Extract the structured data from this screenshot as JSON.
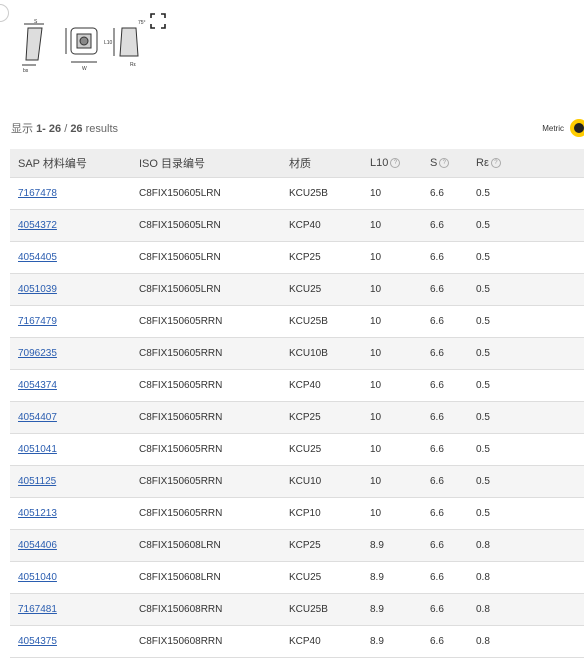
{
  "diagram_labels": {
    "s": "S",
    "w": "W",
    "l10": "L10",
    "angle": "75°",
    "re": "Rε",
    "bs": "bs"
  },
  "summary": {
    "prefix": "显示 ",
    "range": "1- 26",
    "separator": " / ",
    "total": "26",
    "suffix": " results"
  },
  "unit_toggle": {
    "label": "Metric"
  },
  "table": {
    "headers": {
      "sap": "SAP 材料编号",
      "iso": "ISO 目录编号",
      "grade": "材质",
      "l10": "L10",
      "s": "S",
      "re": "Rε"
    },
    "info_glyph": "?",
    "rows": [
      {
        "sap": "7167478",
        "iso": "C8FIX150605LRN",
        "grade": "KCU25B",
        "l10": "10",
        "s": "6.6",
        "re": "0.5"
      },
      {
        "sap": "4054372",
        "iso": "C8FIX150605LRN",
        "grade": "KCP40",
        "l10": "10",
        "s": "6.6",
        "re": "0.5"
      },
      {
        "sap": "4054405",
        "iso": "C8FIX150605LRN",
        "grade": "KCP25",
        "l10": "10",
        "s": "6.6",
        "re": "0.5"
      },
      {
        "sap": "4051039",
        "iso": "C8FIX150605LRN",
        "grade": "KCU25",
        "l10": "10",
        "s": "6.6",
        "re": "0.5"
      },
      {
        "sap": "7167479",
        "iso": "C8FIX150605RRN",
        "grade": "KCU25B",
        "l10": "10",
        "s": "6.6",
        "re": "0.5"
      },
      {
        "sap": "7096235",
        "iso": "C8FIX150605RRN",
        "grade": "KCU10B",
        "l10": "10",
        "s": "6.6",
        "re": "0.5"
      },
      {
        "sap": "4054374",
        "iso": "C8FIX150605RRN",
        "grade": "KCP40",
        "l10": "10",
        "s": "6.6",
        "re": "0.5"
      },
      {
        "sap": "4054407",
        "iso": "C8FIX150605RRN",
        "grade": "KCP25",
        "l10": "10",
        "s": "6.6",
        "re": "0.5"
      },
      {
        "sap": "4051041",
        "iso": "C8FIX150605RRN",
        "grade": "KCU25",
        "l10": "10",
        "s": "6.6",
        "re": "0.5"
      },
      {
        "sap": "4051125",
        "iso": "C8FIX150605RRN",
        "grade": "KCU10",
        "l10": "10",
        "s": "6.6",
        "re": "0.5"
      },
      {
        "sap": "4051213",
        "iso": "C8FIX150605RRN",
        "grade": "KCP10",
        "l10": "10",
        "s": "6.6",
        "re": "0.5"
      },
      {
        "sap": "4054406",
        "iso": "C8FIX150608LRN",
        "grade": "KCP25",
        "l10": "8.9",
        "s": "6.6",
        "re": "0.8"
      },
      {
        "sap": "4051040",
        "iso": "C8FIX150608LRN",
        "grade": "KCU25",
        "l10": "8.9",
        "s": "6.6",
        "re": "0.8"
      },
      {
        "sap": "7167481",
        "iso": "C8FIX150608RRN",
        "grade": "KCU25B",
        "l10": "8.9",
        "s": "6.6",
        "re": "0.8"
      },
      {
        "sap": "4054375",
        "iso": "C8FIX150608RRN",
        "grade": "KCP40",
        "l10": "8.9",
        "s": "6.6",
        "re": "0.8"
      }
    ]
  }
}
